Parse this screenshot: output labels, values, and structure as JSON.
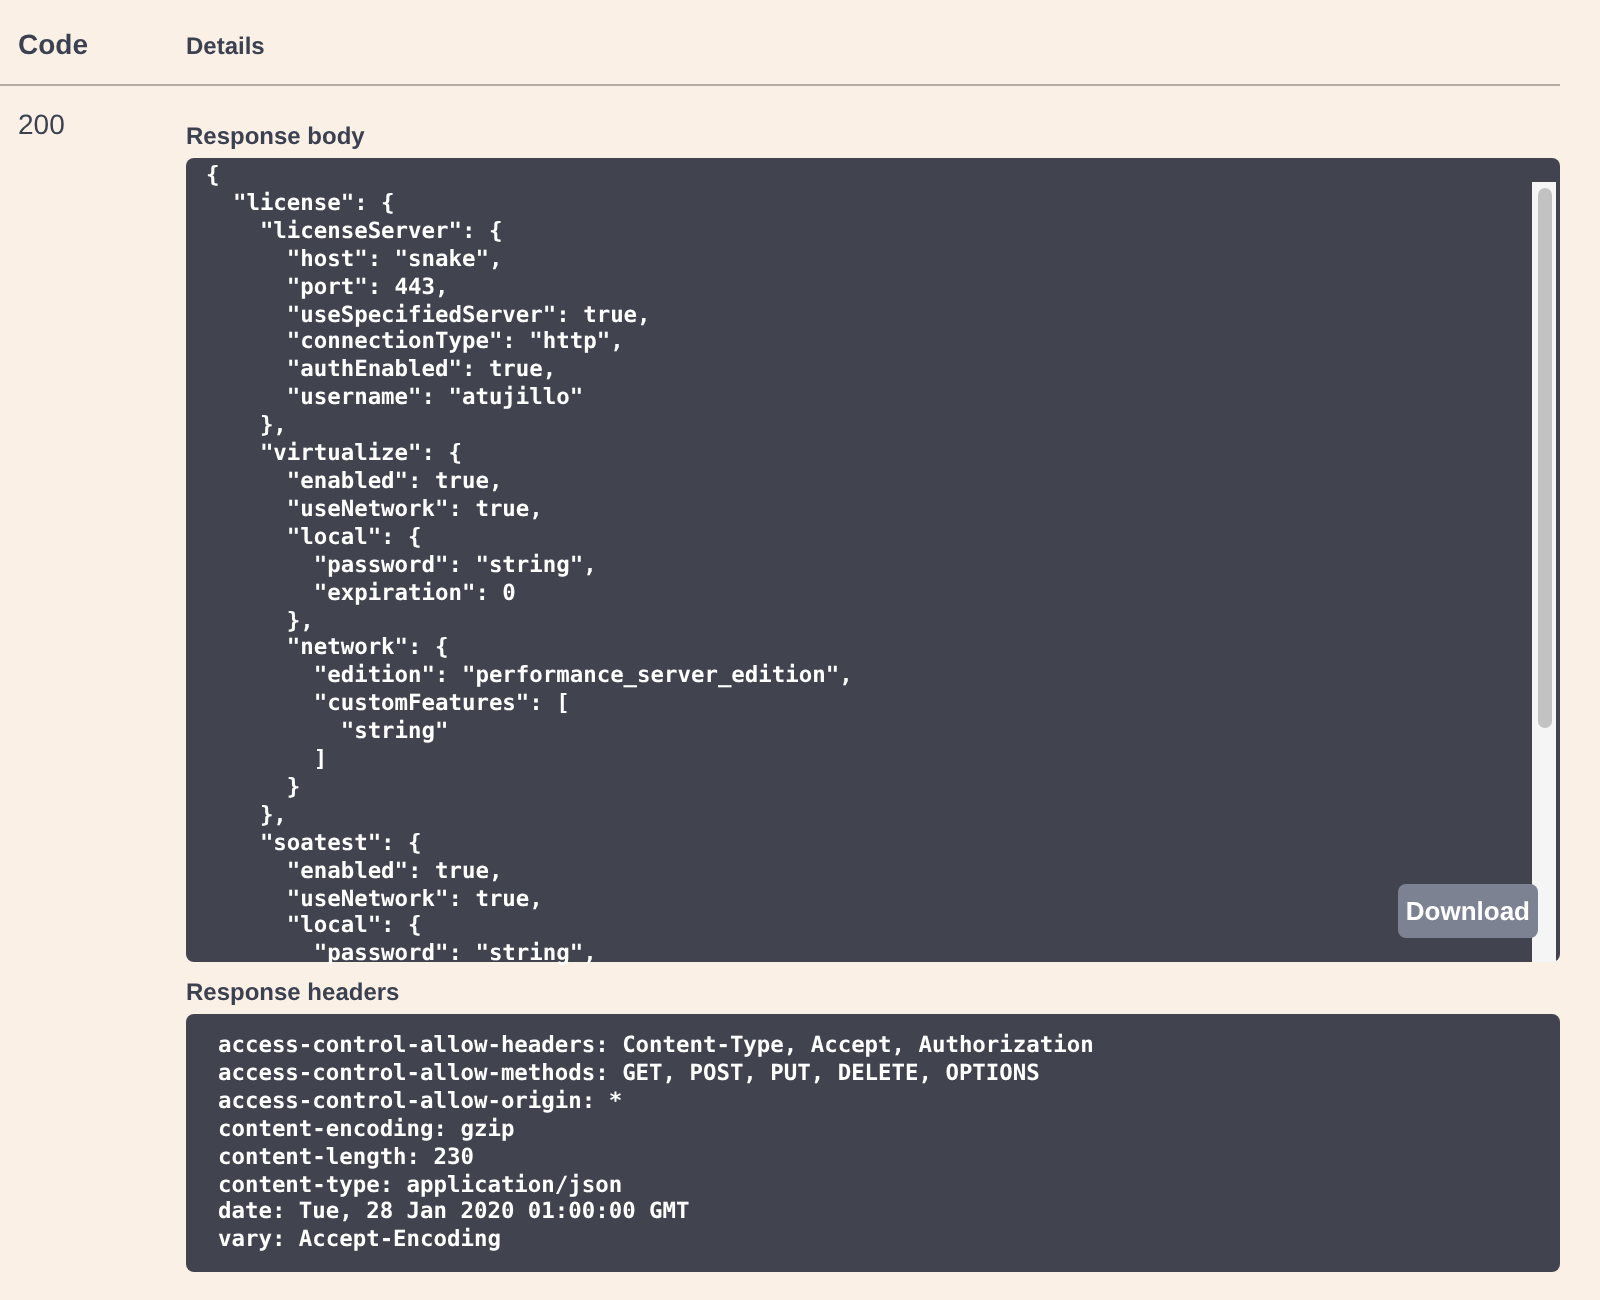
{
  "table": {
    "columns": [
      "Code",
      "Details"
    ],
    "rows": [
      {
        "code": "200",
        "response_body": {
          "label": "Response body",
          "lines": [
            "{",
            "  \"license\": {",
            "    \"licenseServer\": {",
            "      \"host\": \"snake\",",
            "      \"port\": 443,",
            "      \"useSpecifiedServer\": true,",
            "      \"connectionType\": \"http\",",
            "      \"authEnabled\": true,",
            "      \"username\": \"atujillo\"",
            "    },",
            "    \"virtualize\": {",
            "      \"enabled\": true,",
            "      \"useNetwork\": true,",
            "      \"local\": {",
            "        \"password\": \"string\",",
            "        \"expiration\": 0",
            "      },",
            "      \"network\": {",
            "        \"edition\": \"performance_server_edition\",",
            "        \"customFeatures\": [",
            "          \"string\"",
            "        ]",
            "      }",
            "    },",
            "    \"soatest\": {",
            "      \"enabled\": true,",
            "      \"useNetwork\": true,",
            "      \"local\": {",
            "        \"password\": \"string\","
          ],
          "download_button": "Download"
        },
        "response_headers": {
          "label": "Response headers",
          "lines": [
            "access-control-allow-headers: Content-Type, Accept, Authorization",
            "access-control-allow-methods: GET, POST, PUT, DELETE, OPTIONS",
            "access-control-allow-origin: *",
            "content-encoding: gzip",
            "content-length: 230",
            "content-type: application/json",
            "date: Tue, 28 Jan 2020 01:00:00 GMT",
            "vary: Accept-Encoding"
          ]
        }
      }
    ]
  }
}
